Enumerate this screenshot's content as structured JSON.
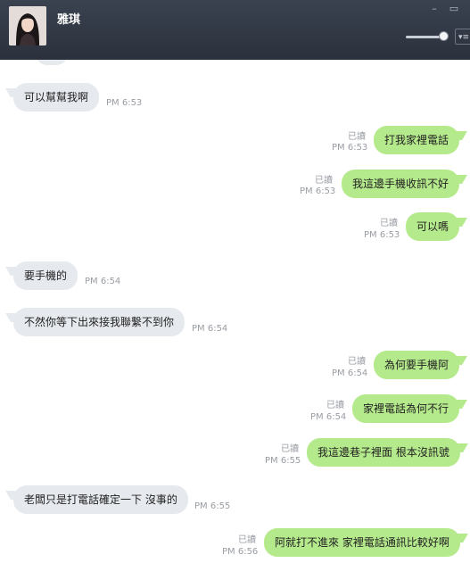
{
  "header": {
    "contact_name": "雅琪",
    "minimize_glyph": "–",
    "maximize_glyph": "▭",
    "menu_glyph": "▾≡"
  },
  "messages": [
    {
      "dir": "in",
      "text": "可以幫幫我啊",
      "time": "PM 6:53"
    },
    {
      "dir": "out",
      "text": "打我家裡電話",
      "time": "PM 6:53",
      "status": "已讀"
    },
    {
      "dir": "out",
      "text": "我這邊手機收訊不好",
      "time": "PM 6:53",
      "status": "已讀"
    },
    {
      "dir": "out",
      "text": "可以嗎",
      "time": "PM 6:53",
      "status": "已讀"
    },
    {
      "dir": "in",
      "text": "要手機的",
      "time": "PM 6:54"
    },
    {
      "dir": "in",
      "text": "不然你等下出來接我聯繫不到你",
      "time": "PM 6:54"
    },
    {
      "dir": "out",
      "text": "為何要手機阿",
      "time": "PM 6:54",
      "status": "已讀"
    },
    {
      "dir": "out",
      "text": "家裡電話為何不行",
      "time": "PM 6:54",
      "status": "已讀"
    },
    {
      "dir": "out",
      "text": "我這邊巷子裡面 根本沒訊號",
      "time": "PM 6:55",
      "status": "已讀"
    },
    {
      "dir": "in",
      "text": "老闆只是打電話確定一下 沒事的",
      "time": "PM 6:55"
    },
    {
      "dir": "out",
      "text": "阿就打不進來 家裡電話通訊比較好啊",
      "time": "PM 6:56",
      "status": "已讀"
    }
  ]
}
